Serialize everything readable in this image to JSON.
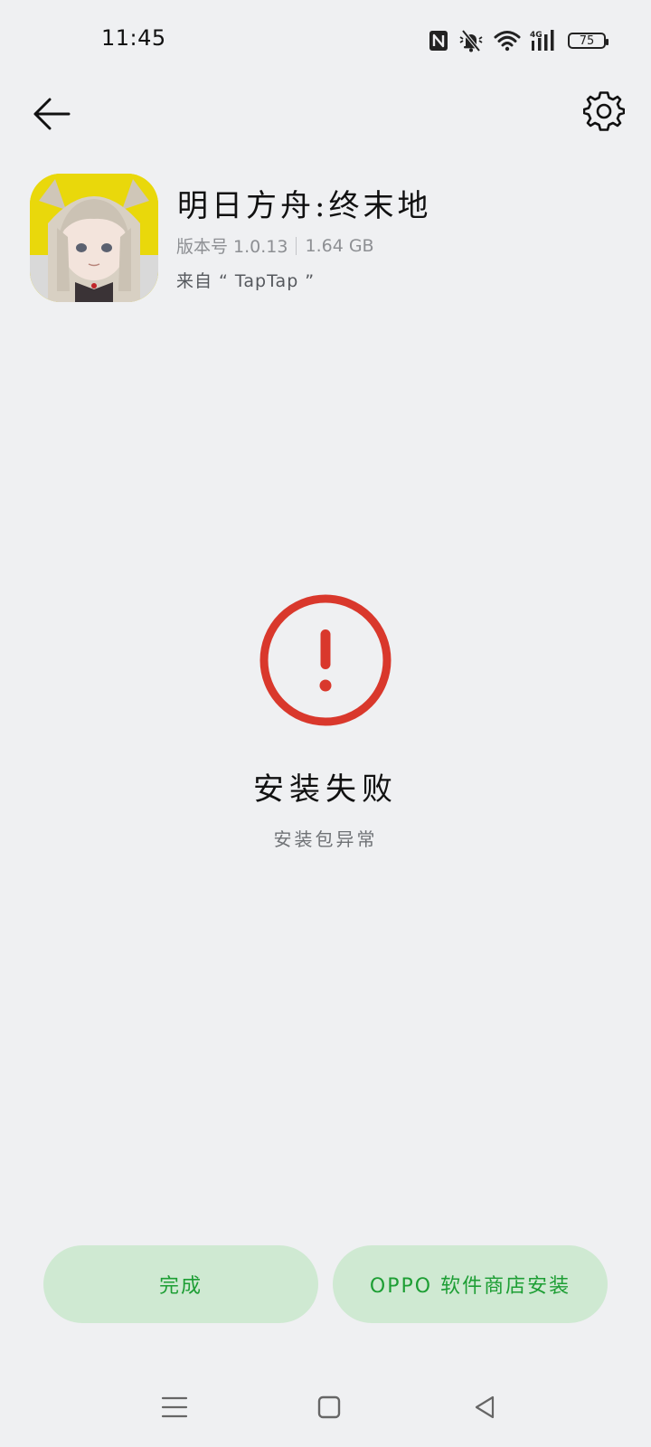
{
  "status_bar": {
    "time": "11:45",
    "battery_level": "75",
    "icons": [
      "nfc-icon",
      "bell-muted-icon",
      "wifi-icon",
      "signal-4g-icon",
      "battery-icon"
    ]
  },
  "header": {
    "back_icon": "arrow-left-icon",
    "settings_icon": "gear-icon"
  },
  "app": {
    "name": "明日方舟:终末地",
    "version_label": "版本号 1.0.13",
    "size": "1.64 GB",
    "source": "来自 “ TapTap ”"
  },
  "result": {
    "icon": "exclamation-circle-icon",
    "title": "安装失败",
    "subtitle": "安装包异常",
    "accent_color": "#d9382c"
  },
  "actions": {
    "done_label": "完成",
    "store_install_label": "OPPO 软件商店安装",
    "button_bg": "#cfe9d2",
    "button_text_color": "#1d9e34"
  },
  "nav_bar": {
    "icons": [
      "menu-icon",
      "home-icon",
      "back-triangle-icon"
    ]
  }
}
